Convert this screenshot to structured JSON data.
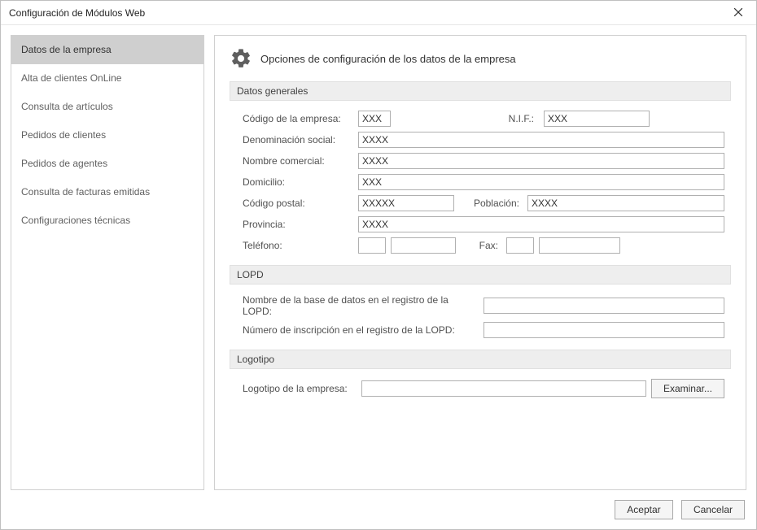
{
  "window": {
    "title": "Configuración de Módulos Web"
  },
  "sidebar": {
    "items": [
      {
        "label": "Datos de la empresa",
        "active": true
      },
      {
        "label": "Alta de clientes OnLine",
        "active": false
      },
      {
        "label": "Consulta de artículos",
        "active": false
      },
      {
        "label": "Pedidos de clientes",
        "active": false
      },
      {
        "label": "Pedidos de agentes",
        "active": false
      },
      {
        "label": "Consulta de facturas emitidas",
        "active": false
      },
      {
        "label": "Configuraciones técnicas",
        "active": false
      }
    ]
  },
  "header": {
    "title": "Opciones de configuración de los datos de la empresa"
  },
  "sections": {
    "general": {
      "title": "Datos generales",
      "codigo_label": "Código de la empresa:",
      "codigo_value": "XXX",
      "nif_label": "N.I.F.:",
      "nif_value": "XXX",
      "denominacion_label": "Denominación social:",
      "denominacion_value": "XXXX",
      "comercial_label": "Nombre comercial:",
      "comercial_value": "XXXX",
      "domicilio_label": "Domicilio:",
      "domicilio_value": "XXX",
      "cp_label": "Código postal:",
      "cp_value": "XXXXX",
      "poblacion_label": "Población:",
      "poblacion_value": "XXXX",
      "provincia_label": "Provincia:",
      "provincia_value": "XXXX",
      "telefono_label": "Teléfono:",
      "telefono1_value": "",
      "telefono2_value": "",
      "fax_label": "Fax:",
      "fax1_value": "",
      "fax2_value": ""
    },
    "lopd": {
      "title": "LOPD",
      "db_label": "Nombre de la base de datos en el registro de la LOPD:",
      "db_value": "",
      "num_label": "Número de inscripción en el registro de la LOPD:",
      "num_value": ""
    },
    "logo": {
      "title": "Logotipo",
      "label": "Logotipo de la empresa:",
      "path_value": "",
      "browse_label": "Examinar..."
    }
  },
  "footer": {
    "ok_label": "Aceptar",
    "cancel_label": "Cancelar"
  }
}
